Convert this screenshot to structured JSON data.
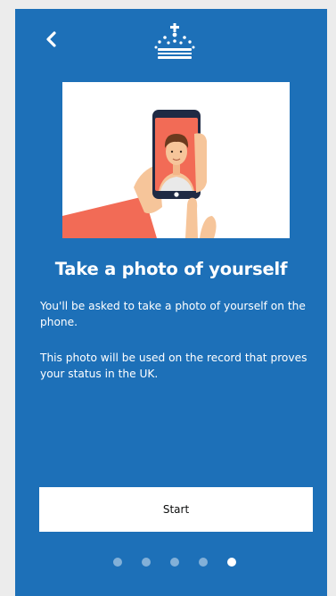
{
  "icons": {
    "back": "chevron-left-icon",
    "crest": "crown-crest-icon"
  },
  "colors": {
    "background": "#1d70b8",
    "button": "#ffffff",
    "page_outer": "#ececec"
  },
  "main": {
    "title": "Take a photo of yourself",
    "paragraph_1": "You'll be asked to take a photo of yourself on the phone.",
    "paragraph_2": "This photo will be used on the record that proves your status in the UK."
  },
  "actions": {
    "start_label": "Start"
  },
  "pagination": {
    "total": 5,
    "current": 5
  }
}
